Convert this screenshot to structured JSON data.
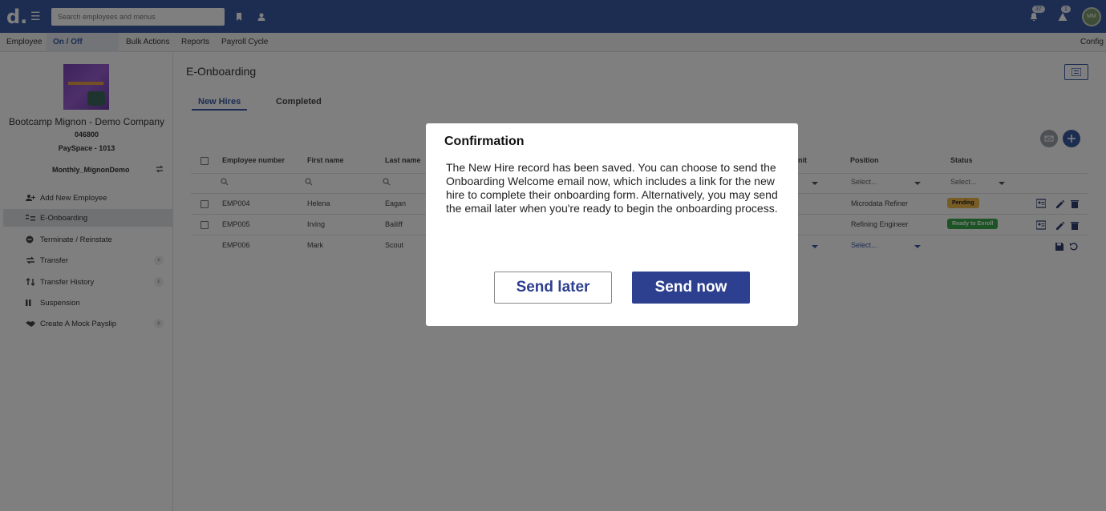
{
  "topbar": {
    "logo": "d.",
    "search_placeholder": "Search employees and menus",
    "notifications_count": "37",
    "alerts_count": "1",
    "avatar_initials": "MM"
  },
  "nav": {
    "items": [
      "Employee",
      "On / Off Boarding",
      "Bulk Actions",
      "Reports",
      "Payroll Cycle"
    ],
    "active": "On / Off Boarding",
    "config": "Config"
  },
  "company": {
    "name": "Bootcamp Mignon - Demo Company",
    "code": "046800",
    "subtitle": "PaySpace - 1013",
    "frequency": "Monthly_MignonDemo"
  },
  "sidebar": {
    "items": [
      {
        "label": "Add New Employee",
        "icon": "person-add-icon"
      },
      {
        "label": "E-Onboarding",
        "icon": "onboarding-icon"
      },
      {
        "label": "Terminate / Reinstate",
        "icon": "minus-circle-icon"
      },
      {
        "label": "Transfer",
        "icon": "swap-icon"
      },
      {
        "label": "Transfer History",
        "icon": "history-icon"
      },
      {
        "label": "Suspension",
        "icon": "pause-icon"
      },
      {
        "label": "Create A Mock Payslip",
        "icon": "handshake-icon"
      }
    ],
    "active": "E-Onboarding",
    "chip": "c"
  },
  "page": {
    "title": "E-Onboarding",
    "tabs": [
      "New Hires",
      "Completed"
    ],
    "active_tab": "New Hires"
  },
  "table": {
    "headers": [
      "Employee number",
      "First name",
      "Last name",
      "nit",
      "Position",
      "Status"
    ],
    "select_placeholder": "Select...",
    "rows": [
      {
        "number": "EMP004",
        "first": "Helena",
        "last": "Eagan",
        "position": "Microdata Refiner",
        "status": "Pending"
      },
      {
        "number": "EMP005",
        "first": "Irving",
        "last": "Bailiff",
        "position": "Refining Engineer",
        "status": "Ready to Enroll"
      },
      {
        "number": "EMP006",
        "first": "Mark",
        "last": "Scout",
        "position": "Select...",
        "status": ""
      }
    ]
  },
  "colors": {
    "brand": "#3b5ba5",
    "pending": "#f0b94a",
    "ready": "#3aa84a",
    "button_primary": "#2d3f8f"
  },
  "modal": {
    "title": "Confirmation",
    "body": "The New Hire record has been saved. You can choose to send the Onboarding Welcome email now, which includes a link for the new hire to complete their onboarding form. Alternatively, you may send the email later when you're ready to begin the onboarding process.",
    "send_later": "Send later",
    "send_now": "Send now"
  }
}
